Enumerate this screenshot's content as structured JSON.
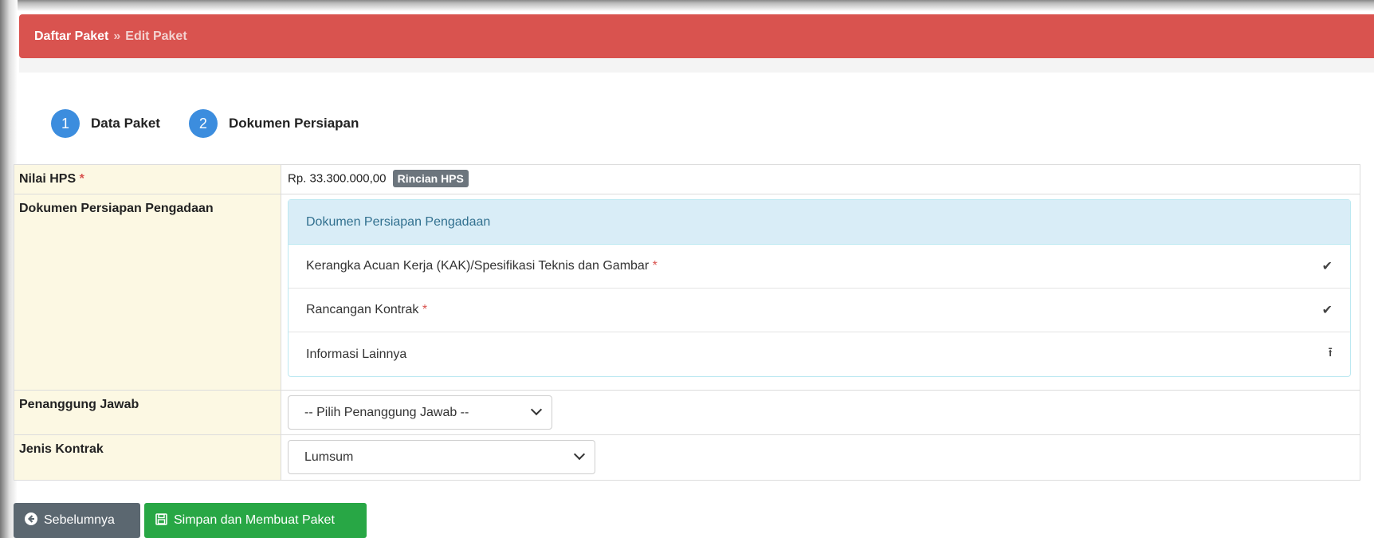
{
  "breadcrumb": {
    "parent": "Daftar Paket",
    "separator": "»",
    "current": "Edit Paket"
  },
  "wizard": {
    "steps": [
      {
        "number": "1",
        "label": "Data Paket"
      },
      {
        "number": "2",
        "label": "Dokumen Persiapan"
      }
    ]
  },
  "form": {
    "hps": {
      "label": "Nilai HPS",
      "required_mark": "*",
      "amount": "Rp. 33.300.000,00",
      "detail_badge": "Rincian HPS"
    },
    "documents": {
      "label": "Dokumen Persiapan Pengadaan",
      "panel_title": "Dokumen Persiapan Pengadaan",
      "items": [
        {
          "label": "Kerangka Acuan Kerja (KAK)/Spesifikasi Teknis dan Gambar",
          "required_mark": "*",
          "icon": "check-icon",
          "glyph": "✔"
        },
        {
          "label": "Rancangan Kontrak",
          "required_mark": "*",
          "icon": "check-icon",
          "glyph": "✔"
        },
        {
          "label": "Informasi Lainnya",
          "required_mark": "",
          "icon": "upload-icon",
          "glyph": "⭱"
        }
      ]
    },
    "responsible": {
      "label": "Penanggung Jawab",
      "selected": "-- Pilih Penanggung Jawab --"
    },
    "contract_type": {
      "label": "Jenis Kontrak",
      "selected": "Lumsum"
    }
  },
  "buttons": {
    "back": {
      "label": "Sebelumnya",
      "icon": "arrow-left-circle-icon",
      "glyph": "➜"
    },
    "save": {
      "label": "Simpan dan Membuat Paket",
      "icon": "floppy-disk-icon",
      "glyph": "🖫"
    }
  },
  "colors": {
    "header": "#d9534f",
    "step": "#3c8dde",
    "label_bg": "#fcf8e3",
    "panel_heading": "#d9edf7",
    "back_button": "#5b6770",
    "save_button": "#28a745",
    "required": "#d9534f"
  }
}
